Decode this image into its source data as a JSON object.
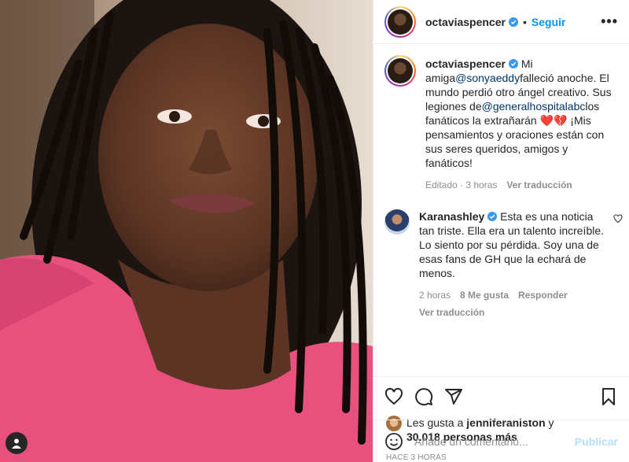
{
  "post": {
    "author": "octaviaspencer",
    "follow_label": "Seguir",
    "more_label": "•••",
    "dot": "•"
  },
  "caption": {
    "user": "octaviaspencer",
    "text_1": "Mi amiga",
    "mention_1": "@sonyaeddy",
    "text_2": "falleció anoche. El mundo perdió otro ángel creativo. Sus legiones de",
    "mention_2": "@generalhospitalabc",
    "text_3": "los fanáticos la extrañarán ❤️💔 ¡Mis pensamientos y oraciones están con sus seres queridos, amigos y fanáticos!",
    "edited": "Editado · 3 horas",
    "translate": "Ver traducción"
  },
  "reply": {
    "user": "Karanashley",
    "text": "Esta es una noticia tan triste. Ella era un talento increíble. Lo siento por su pérdida. Soy una de esas fans de GH que la echará de menos.",
    "time": "2 horas",
    "likes": "8 Me gusta",
    "reply_label": "Responder",
    "translate": "Ver traducción"
  },
  "likes": {
    "prefix": "Les gusta a ",
    "user": "jenniferaniston",
    "mid": " y",
    "count": "30.018 personas más"
  },
  "timestamp": "HACE 3 HORAS",
  "composer": {
    "placeholder": "Añade un comentario...",
    "publish": "Publicar"
  },
  "colors": {
    "accent": "#0095f6",
    "verified": "#3897f0",
    "shirt": "#e8507e"
  },
  "icons": [
    "heart-icon",
    "comment-icon",
    "share-icon",
    "bookmark-icon",
    "emoji-icon",
    "more-icon",
    "verified-icon",
    "user-tag-icon"
  ]
}
